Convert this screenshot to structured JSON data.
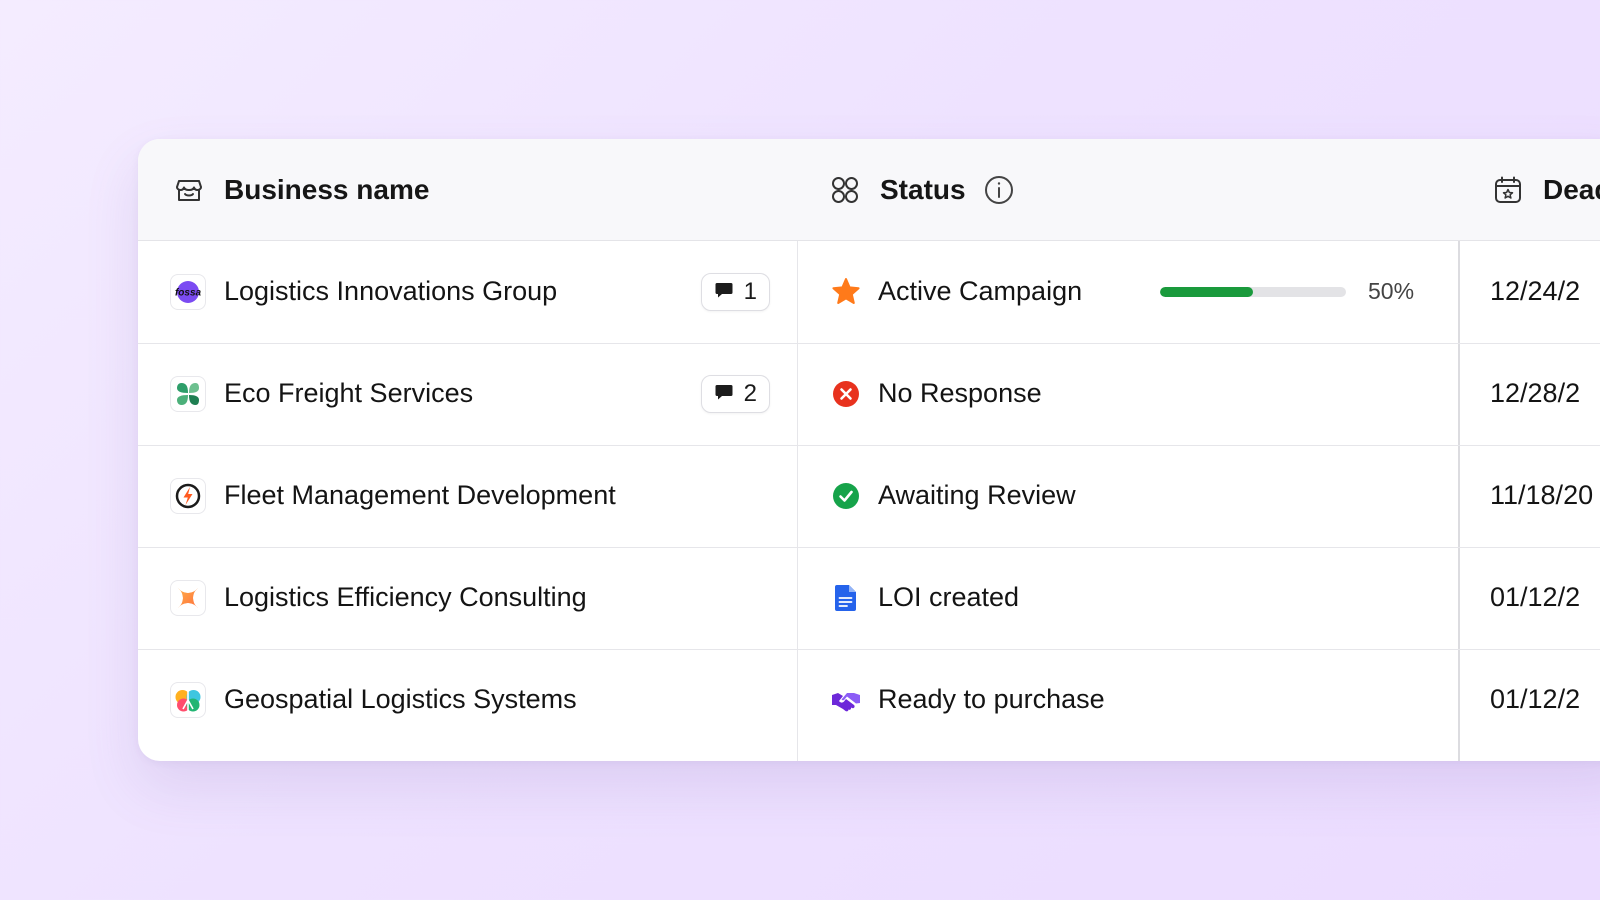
{
  "columns": {
    "business": "Business name",
    "status": "Status",
    "deadline": "Dead"
  },
  "rows": [
    {
      "name": "Logistics Innovations Group",
      "logo_text": "fossa",
      "comments": "1",
      "status": "Active Campaign",
      "status_icon": "star-icon",
      "progress": 0.5,
      "progress_label": "50%",
      "deadline": "12/24/2"
    },
    {
      "name": "Eco Freight Services",
      "comments": "2",
      "status": "No Response",
      "status_icon": "x-circle-icon",
      "deadline": "12/28/2"
    },
    {
      "name": "Fleet Management Development",
      "status": "Awaiting Review",
      "status_icon": "check-circle-icon",
      "deadline": "11/18/20"
    },
    {
      "name": "Logistics Efficiency Consulting",
      "status": "LOI created",
      "status_icon": "document-icon",
      "deadline": "01/12/2"
    },
    {
      "name": "Geospatial Logistics Systems",
      "status": "Ready to purchase",
      "status_icon": "handshake-icon",
      "deadline": "01/12/2"
    }
  ],
  "colors": {
    "star": "#ff7a1a",
    "no_response": "#e8321e",
    "awaiting": "#16a34a",
    "loi": "#2563eb",
    "ready": "#6d28d9",
    "progress": "#1a9a3c"
  }
}
